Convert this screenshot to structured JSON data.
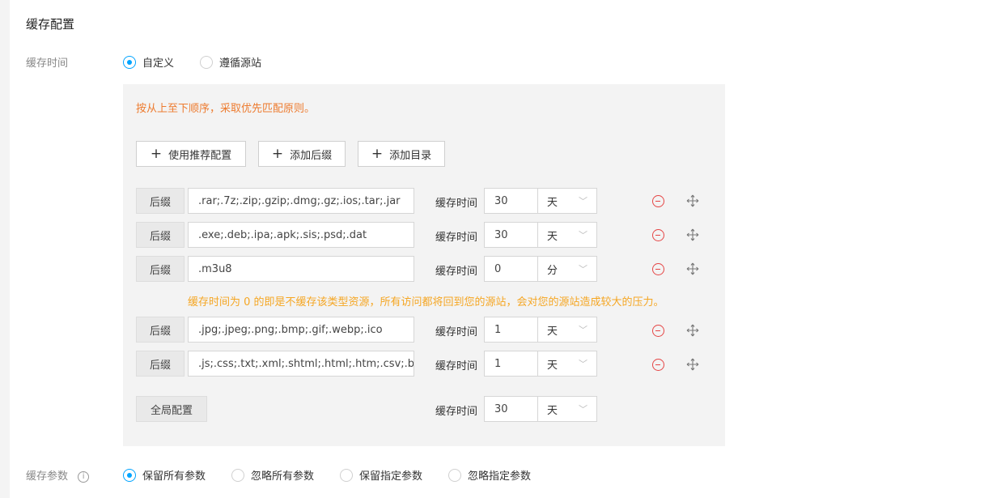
{
  "section_title": "缓存配置",
  "cache_time": {
    "label": "缓存时间",
    "options": [
      {
        "label": "自定义",
        "checked": true
      },
      {
        "label": "遵循源站",
        "checked": false
      }
    ]
  },
  "panel": {
    "hint": "按从上至下顺序，采取优先匹配原则。",
    "buttons": {
      "use_recommended": "使用推荐配置",
      "add_suffix": "添加后缀",
      "add_directory": "添加目录"
    },
    "rules": [
      {
        "type": "后缀",
        "value": ".rar;.7z;.zip;.gzip;.dmg;.gz;.ios;.tar;.jar",
        "time_label": "缓存时间",
        "time": "30",
        "unit": "天"
      },
      {
        "type": "后缀",
        "value": ".exe;.deb;.ipa;.apk;.sis;.psd;.dat",
        "time_label": "缓存时间",
        "time": "30",
        "unit": "天"
      },
      {
        "type": "后缀",
        "value": ".m3u8",
        "time_label": "缓存时间",
        "time": "0",
        "unit": "分"
      },
      {
        "type": "后缀",
        "value": ".jpg;.jpeg;.png;.bmp;.gif;.webp;.ico",
        "time_label": "缓存时间",
        "time": "1",
        "unit": "天"
      },
      {
        "type": "后缀",
        "value": ".js;.css;.txt;.xml;.shtml;.html;.htm;.csv;.ba",
        "time_label": "缓存时间",
        "time": "1",
        "unit": "天"
      }
    ],
    "zero_warning": "缓存时间为 0 的即是不缓存该类型资源，所有访问都将回到您的源站，会对您的源站造成较大的压力。",
    "global": {
      "label": "全局配置",
      "time_label": "缓存时间",
      "time": "30",
      "unit": "天"
    }
  },
  "cache_params": {
    "label": "缓存参数",
    "info_icon": "i",
    "options": [
      {
        "label": "保留所有参数",
        "checked": true
      },
      {
        "label": "忽略所有参数",
        "checked": false
      },
      {
        "label": "保留指定参数",
        "checked": false
      },
      {
        "label": "忽略指定参数",
        "checked": false
      }
    ]
  },
  "colors": {
    "accent": "#00a4ff",
    "hint": "#ed7b2f",
    "warning": "#f5a623",
    "remove": "#e54545"
  }
}
